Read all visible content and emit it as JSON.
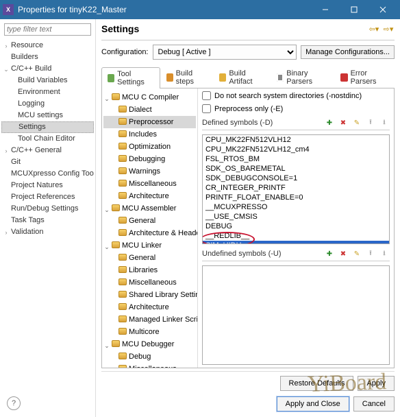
{
  "window": {
    "title": "Properties for tinyK22_Master"
  },
  "filter": {
    "placeholder": "type filter text"
  },
  "leftTree": [
    {
      "label": "Resource",
      "lvl": 0,
      "tw": ">"
    },
    {
      "label": "Builders",
      "lvl": 0
    },
    {
      "label": "C/C++ Build",
      "lvl": 0,
      "tw": "v"
    },
    {
      "label": "Build Variables",
      "lvl": 1
    },
    {
      "label": "Environment",
      "lvl": 1
    },
    {
      "label": "Logging",
      "lvl": 1
    },
    {
      "label": "MCU settings",
      "lvl": 1
    },
    {
      "label": "Settings",
      "lvl": 1,
      "selected": true
    },
    {
      "label": "Tool Chain Editor",
      "lvl": 1
    },
    {
      "label": "C/C++ General",
      "lvl": 0,
      "tw": ">"
    },
    {
      "label": "Git",
      "lvl": 0
    },
    {
      "label": "MCUXpresso Config Tools",
      "lvl": 0
    },
    {
      "label": "Project Natures",
      "lvl": 0
    },
    {
      "label": "Project References",
      "lvl": 0
    },
    {
      "label": "Run/Debug Settings",
      "lvl": 0
    },
    {
      "label": "Task Tags",
      "lvl": 0
    },
    {
      "label": "Validation",
      "lvl": 0,
      "tw": ">"
    }
  ],
  "settings": {
    "heading": "Settings",
    "configLabel": "Configuration:",
    "configValue": "Debug  [ Active ]",
    "manageBtn": "Manage Configurations..."
  },
  "tabs": [
    {
      "label": "Tool Settings",
      "icon": "ic-tool",
      "active": true
    },
    {
      "label": "Build steps",
      "icon": "ic-steps"
    },
    {
      "label": "Build Artifact",
      "icon": "ic-art"
    },
    {
      "label": "Binary Parsers",
      "icon": "ic-bin"
    },
    {
      "label": "Error Parsers",
      "icon": "ic-err"
    }
  ],
  "toolTree": [
    {
      "label": "MCU C Compiler",
      "group": true
    },
    {
      "label": "Dialect"
    },
    {
      "label": "Preprocessor",
      "selected": true
    },
    {
      "label": "Includes"
    },
    {
      "label": "Optimization"
    },
    {
      "label": "Debugging"
    },
    {
      "label": "Warnings"
    },
    {
      "label": "Miscellaneous"
    },
    {
      "label": "Architecture"
    },
    {
      "label": "MCU Assembler",
      "group": true
    },
    {
      "label": "General"
    },
    {
      "label": "Architecture & Headers"
    },
    {
      "label": "MCU Linker",
      "group": true
    },
    {
      "label": "General"
    },
    {
      "label": "Libraries"
    },
    {
      "label": "Miscellaneous"
    },
    {
      "label": "Shared Library Settings"
    },
    {
      "label": "Architecture"
    },
    {
      "label": "Managed Linker Script"
    },
    {
      "label": "Multicore"
    },
    {
      "label": "MCU Debugger",
      "group": true
    },
    {
      "label": "Debug"
    },
    {
      "label": "Miscellaneous"
    }
  ],
  "checks": {
    "nostdinc": "Do not search system directories (-nostdinc)",
    "preonly": "Preprocess only (-E)"
  },
  "definedHeader": "Defined symbols (-D)",
  "undefinedHeader": "Undefined symbols (-U)",
  "definedSymbols": [
    "CPU_MK22FN512VLH12",
    "CPU_MK22FN512VLH12_cm4",
    "FSL_RTOS_BM",
    "SDK_OS_BAREMETAL",
    "SDK_DEBUGCONSOLE=1",
    "CR_INTEGER_PRINTF",
    "PRINTF_FLOAT_ENABLE=0",
    "__MCUXPRESSO",
    "__USE_CMSIS",
    "DEBUG",
    "__REDLIB__",
    "SIM_UIDH"
  ],
  "selectedSymbolIndex": 11,
  "footer": {
    "restore": "Restore Defaults",
    "apply": "Apply",
    "applyClose": "Apply and Close",
    "cancel": "Cancel"
  },
  "watermark": "YiBoard"
}
